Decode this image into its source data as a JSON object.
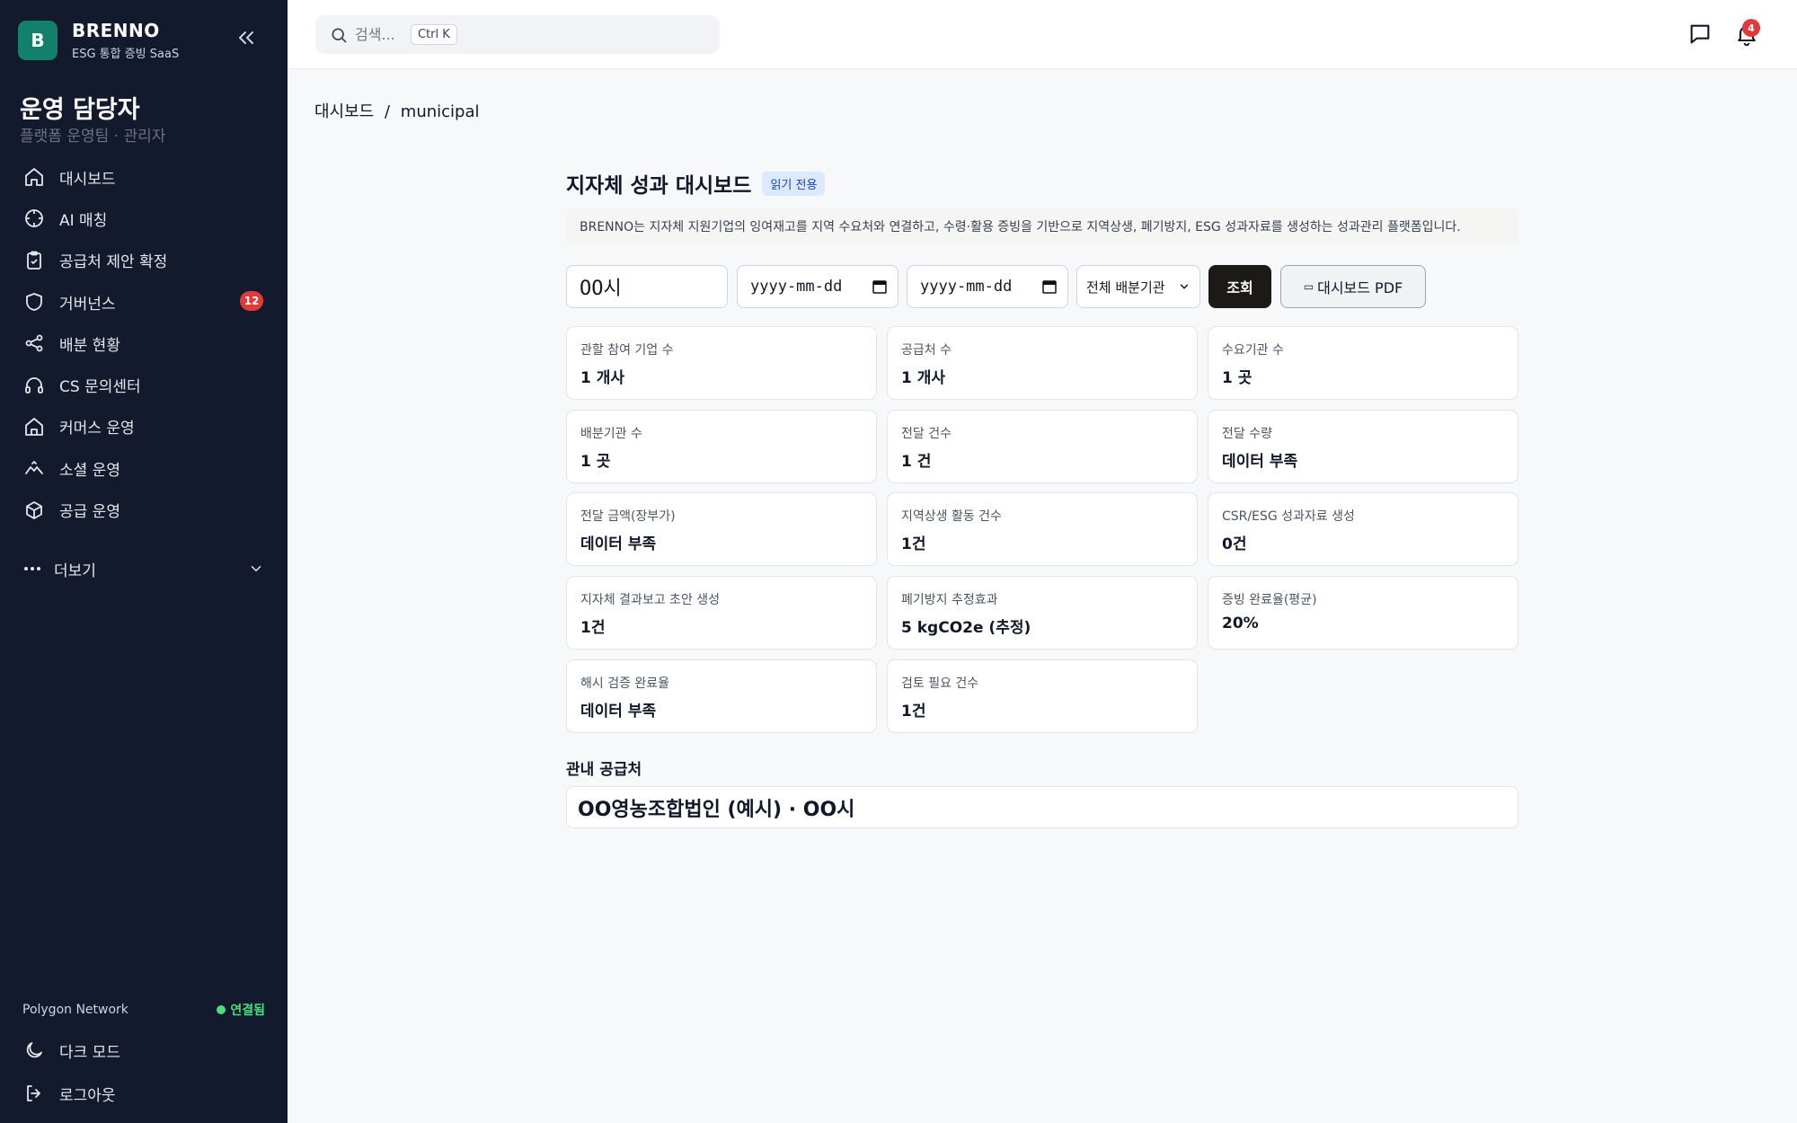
{
  "brand": {
    "logo_letter": "B",
    "name": "BRENNO",
    "subtitle": "ESG 통합 증빙 SaaS"
  },
  "user": {
    "name": "운영 담당자",
    "role": "플랫폼 운영팀 · 관리자"
  },
  "nav": {
    "items": [
      {
        "label": "대시보드",
        "icon": "home-icon"
      },
      {
        "label": "AI 매칭",
        "icon": "crosshair-icon"
      },
      {
        "label": "공급처 제안 확정",
        "icon": "clipboard-check-icon"
      },
      {
        "label": "거버넌스",
        "icon": "shield-icon",
        "badge": "12"
      },
      {
        "label": "배분 현황",
        "icon": "share-icon"
      },
      {
        "label": "CS 문의센터",
        "icon": "headphones-icon"
      },
      {
        "label": "커머스 운영",
        "icon": "store-icon"
      },
      {
        "label": "소셜 운영",
        "icon": "handshake-icon"
      },
      {
        "label": "공급 운영",
        "icon": "box-icon"
      }
    ],
    "more_label": "더보기"
  },
  "network": {
    "name": "Polygon Network",
    "status": "연결됨",
    "status_color": "#4ade80"
  },
  "bottom": {
    "dark_mode": "다크 모드",
    "logout": "로그아웃"
  },
  "topbar": {
    "search_placeholder": "검색...",
    "shortcut": "Ctrl K",
    "notification_count": "4"
  },
  "breadcrumb": {
    "root": "대시보드",
    "separator": "/",
    "current": "municipal"
  },
  "page": {
    "title": "지자체 성과 대시보드",
    "badge": "읽기 전용",
    "description": "BRENNO는 지자체 지원기업의 잉여재고를 지역 수요처와 연결하고, 수령·활용 증빙을 기반으로 지역상생, 폐기방지, ESG 성과자료를 생성하는 성과관리 플랫폼입니다."
  },
  "filters": {
    "region": "OO시",
    "date_placeholder": "yyyy-mm-dd",
    "distributor_select": "전체 배분기관",
    "query_button": "조회",
    "pdf_button": "대시보드 PDF"
  },
  "cards": [
    {
      "label": "관할 참여 기업 수",
      "value": "1 개사"
    },
    {
      "label": "공급처 수",
      "value": "1 개사"
    },
    {
      "label": "수요기관 수",
      "value": "1 곳"
    },
    {
      "label": "배분기관 수",
      "value": "1 곳"
    },
    {
      "label": "전달 건수",
      "value": "1 건"
    },
    {
      "label": "전달 수량",
      "value": "데이터 부족"
    },
    {
      "label": "전달 금액(장부가)",
      "value": "데이터 부족"
    },
    {
      "label": "지역상생 활동 건수",
      "value": "1건"
    },
    {
      "label": "CSR/ESG 성과자료 생성",
      "value": "0건"
    },
    {
      "label": "지자체 결과보고 초안 생성",
      "value": "1건"
    },
    {
      "label": "폐기방지 추정효과",
      "value": "5 kgCO2e (추정)"
    },
    {
      "label": "증빙 완료율(평균)",
      "value": "20%"
    },
    {
      "label": "해시 검증 완료율",
      "value": "데이터 부족"
    },
    {
      "label": "검토 필요 건수",
      "value": "1건"
    }
  ],
  "suppliers": {
    "title": "관내 공급처",
    "items": [
      "OO영농조합법인 (예시) · OO시"
    ]
  },
  "colors": {
    "sidebar": "#141a2e",
    "logo": "#13806b",
    "badge": "#e23a3a",
    "primary_button": "#1c1a17",
    "readonly_badge_bg": "#dbeafe"
  }
}
